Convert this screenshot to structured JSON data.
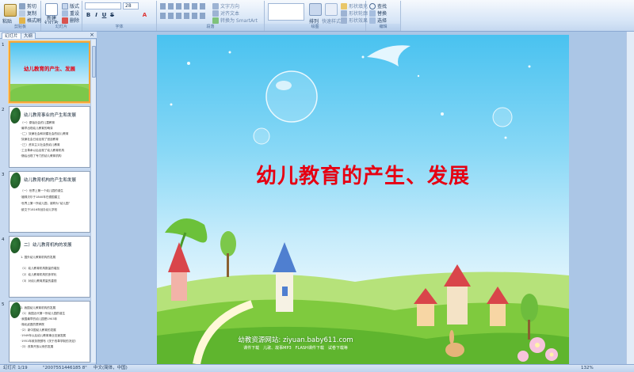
{
  "ribbon": {
    "clipboard": {
      "paste_label": "粘贴",
      "cut_label": "剪切",
      "copy_label": "复制",
      "format_painter_label": "格式刷",
      "group_label": "剪贴板"
    },
    "slides": {
      "new_slide_label": "新建",
      "new_slide_label2": "幻灯片",
      "layout_label": "版式",
      "reset_label": "重设",
      "delete_label": "删除",
      "group_label": "幻灯片"
    },
    "font": {
      "font_size": "28",
      "group_label": "字体"
    },
    "paragraph": {
      "text_direction_label": "文字方向",
      "align_text_label": "对齐文本",
      "smartart_label": "转换为 SmartArt",
      "group_label": "段落"
    },
    "drawing": {
      "arrange_label": "排列",
      "quick_styles_label": "快速样式",
      "fill_label": "形状填充",
      "outline_label": "形状轮廓",
      "effects_label": "形状效果",
      "group_label": "绘图"
    },
    "editing": {
      "find_label": "查找",
      "replace_label": "替换",
      "select_label": "选择",
      "group_label": "编辑"
    }
  },
  "left_panel": {
    "tab_slides": "幻灯片",
    "tab_outline": "大纲",
    "close_glyph": "×",
    "slides": [
      {
        "num": "1",
        "title": "幼儿教育的产生、发展",
        "lines": []
      },
      {
        "num": "2",
        "title": "幼儿教育事业的产生和发展",
        "lines": [
          "（一）原始社会的儿童教育",
          "·最早出现幼儿教育的萌芽",
          "·（二）奴隶社会和封建社会的幼儿教育",
          "·奴隶社会已经出现了宫廷教育",
          "·（三）资本主义社会的幼儿教育",
          "·工业革命以后出现了幼儿教育机构",
          "·随后出现了专门的幼儿教育机构"
        ]
      },
      {
        "num": "3",
        "title": "幼儿教育机构的产生和发展",
        "lines": [
          "（一）世界上第一个幼儿园的诞生",
          "·福禄贝尔于1840年在德国建立",
          "·世界上第一所幼儿园，被称为“幼儿园”",
          "·欧文于1816年创办幼儿学校"
        ]
      },
      {
        "num": "4",
        "title": "二）幼儿教育机构的发展",
        "lines": [
          "1. 国外幼儿教育机构的发展",
          "（1）幼儿教育机构数量的增加",
          "（2）幼儿教育机构的多样化",
          "（3）对幼儿教育质量的重视"
        ]
      },
      {
        "num": "5",
        "title": "",
        "lines": [
          "2. 我国幼儿教育机构的发展",
          "（1）我国近代第一所幼儿园的诞生",
          "·我国最早的幼儿园是1903年",
          "·湖北武昌的蒙养院",
          "·（2）新中国幼儿教育的发展",
          "·1949年以后幼儿教育事业迅速发展",
          "·1951年政务院颁布《关于改革学制的决定》",
          "·（3）改革开放以来的发展"
        ]
      }
    ]
  },
  "slide": {
    "title": "幼儿教育的产生、发展",
    "footer_main": "幼教资源网站: ziyuan.baby611.com",
    "footer_sub": "课件下载　儿歌、故事MP3　FLASH课件下载　试卷下载等"
  },
  "statusbar": {
    "slide_counter": "幻灯片 1/19",
    "theme": "\"2007551446185 8\"",
    "language": "中文(简体，中国)",
    "zoom": "132%"
  }
}
